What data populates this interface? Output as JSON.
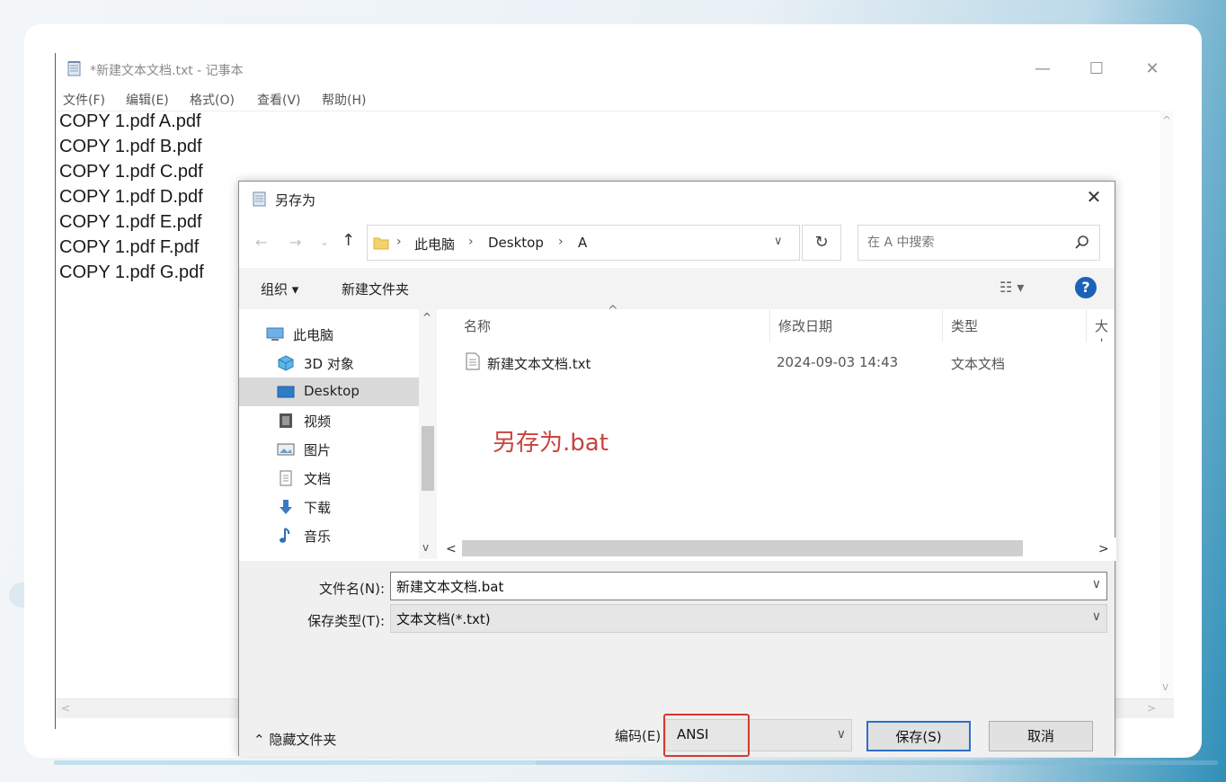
{
  "notepad": {
    "title": "*新建文本文档.txt - 记事本",
    "menu": [
      "文件(F)",
      "编辑(E)",
      "格式(O)",
      "查看(V)",
      "帮助(H)"
    ],
    "lines": [
      "COPY 1.pdf A.pdf",
      "COPY 1.pdf B.pdf",
      "COPY 1.pdf C.pdf",
      "COPY 1.pdf D.pdf",
      "COPY 1.pdf E.pdf",
      "COPY 1.pdf F.pdf",
      "COPY 1.pdf G.pdf"
    ],
    "window_buttons": {
      "minimize": "—",
      "maximize": "☐",
      "close": "✕"
    }
  },
  "dialog": {
    "title": "另存为",
    "close": "✕",
    "nav": {
      "back": "←",
      "forward": "→",
      "recent": "⌄",
      "up": "↑"
    },
    "breadcrumb": [
      "此电脑",
      "Desktop",
      "A"
    ],
    "breadcrumb_sep": "›",
    "address_dropdown": "∨",
    "refresh": "↻",
    "search_placeholder": "在 A 中搜索",
    "toolbar": {
      "organize": "组织 ▾",
      "new_folder": "新建文件夹",
      "view": "☷ ▾",
      "help": "?"
    },
    "nav_items": [
      {
        "label": "此电脑",
        "icon": "computer-icon"
      },
      {
        "label": "3D 对象",
        "icon": "cube-icon"
      },
      {
        "label": "Desktop",
        "icon": "desktop-icon"
      },
      {
        "label": "视频",
        "icon": "video-icon"
      },
      {
        "label": "图片",
        "icon": "picture-icon"
      },
      {
        "label": "文档",
        "icon": "document-icon"
      },
      {
        "label": "下载",
        "icon": "download-icon"
      },
      {
        "label": "音乐",
        "icon": "music-icon"
      }
    ],
    "columns": [
      "名称",
      "修改日期",
      "类型",
      "大小"
    ],
    "sort_caret": "^",
    "files": [
      {
        "name": "新建文本文档.txt",
        "date": "2024-09-03 14:43",
        "type": "文本文档"
      }
    ],
    "annotation": "另存为.bat",
    "filename_label": "文件名(N):",
    "filename_value": "新建文本文档.bat",
    "filetype_label": "保存类型(T):",
    "filetype_value": "文本文档(*.txt)",
    "hide_folders": "⌃ 隐藏文件夹",
    "encoding_label": "编码(E)",
    "encoding_value": "ANSI",
    "save_button": "保存(S)",
    "cancel_button": "取消",
    "dd_caret": "∨",
    "scroll": {
      "up": "^",
      "down": "v",
      "left": "<",
      "right": ">"
    }
  },
  "colors": {
    "accent": "#2d6fc7",
    "highlight": "#d33a2f",
    "annotation": "#c8433f",
    "help": "#1c63b7"
  }
}
